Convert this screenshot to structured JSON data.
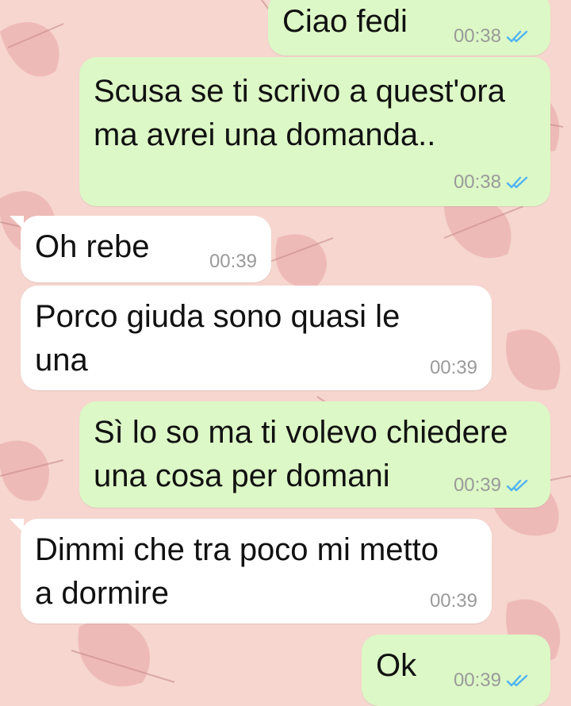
{
  "theme": {
    "wallpaper": "#f6d6cf",
    "outgoing_bubble": "#dcf8c6",
    "incoming_bubble": "#ffffff",
    "read_tick": "#4fb3f2",
    "timestamp": "#9a9a9a"
  },
  "messages": [
    {
      "direction": "out",
      "text": "Ciao fedi",
      "time": "00:38",
      "status": "read"
    },
    {
      "direction": "out",
      "text": "Scusa se ti scrivo a quest'ora\nma avrei una domanda..",
      "time": "00:38",
      "status": "read"
    },
    {
      "direction": "in",
      "text": "Oh rebe",
      "time": "00:39"
    },
    {
      "direction": "in",
      "text": "Porco giuda sono quasi le\nuna",
      "time": "00:39"
    },
    {
      "direction": "out",
      "text": "Sì lo so ma ti volevo chiedere\nuna cosa per domani",
      "time": "00:39",
      "status": "read"
    },
    {
      "direction": "in",
      "text": "Dimmi che tra poco mi metto\na dormire",
      "time": "00:39"
    },
    {
      "direction": "out",
      "text": "Ok",
      "time": "00:39",
      "status": "read"
    }
  ]
}
